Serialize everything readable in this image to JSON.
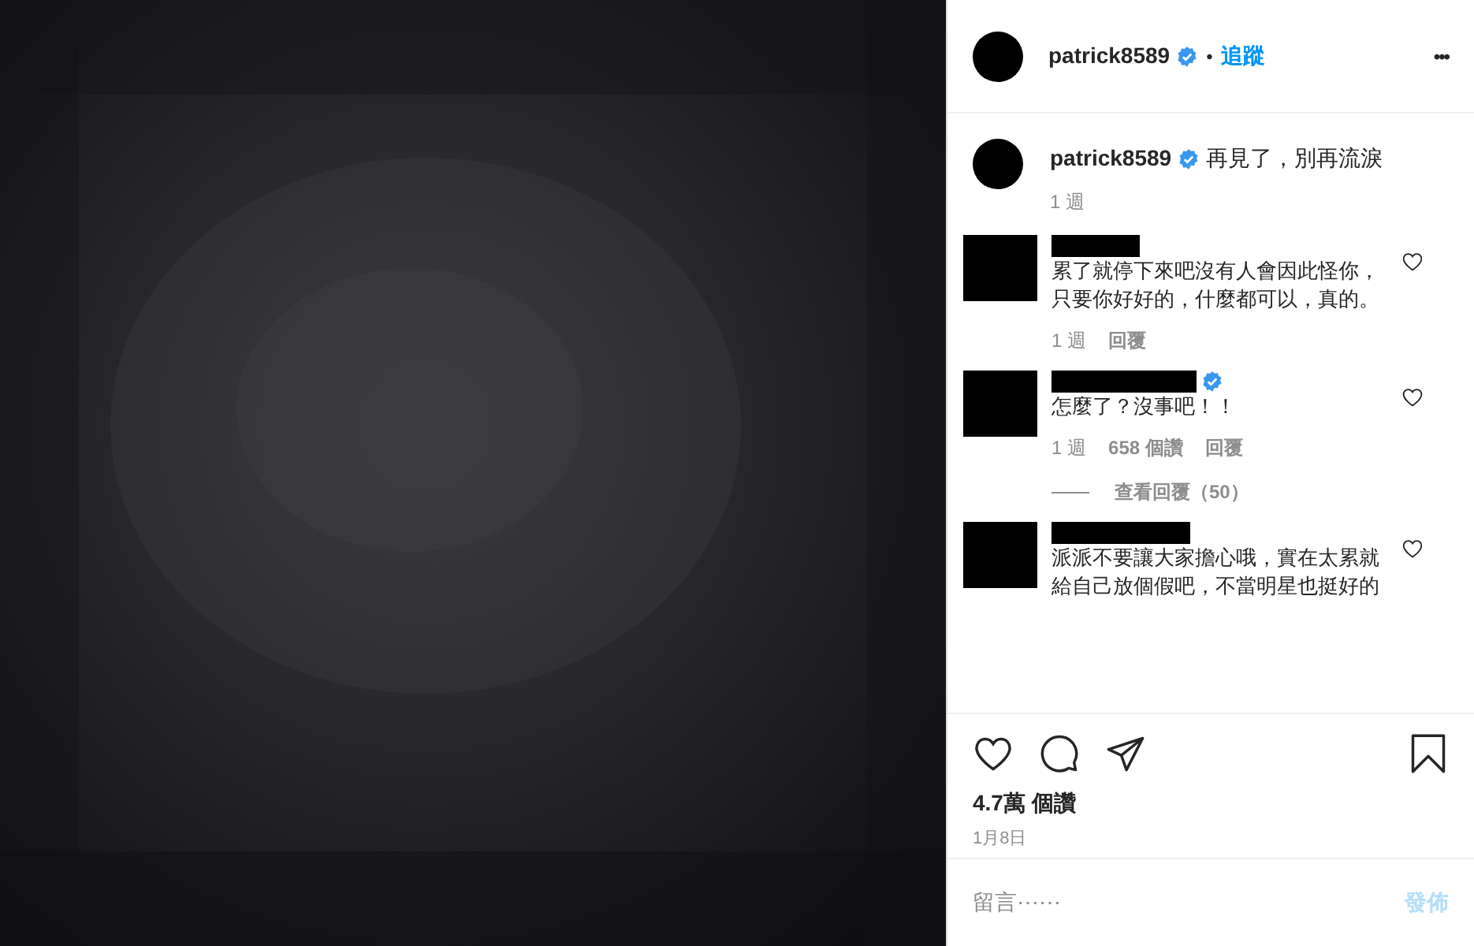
{
  "header": {
    "username": "patrick8589",
    "verified": true,
    "separator": "•",
    "follow": "追蹤",
    "more": "•••"
  },
  "caption": {
    "username": "patrick8589",
    "verified": true,
    "text": "再見了，別再流淚",
    "time": "1 週"
  },
  "comments": [
    {
      "verified": false,
      "text": "累了就停下來吧沒有人會因此怪你，只要你好好的，什麼都可以，真的。",
      "time": "1 週",
      "reply": "回覆"
    },
    {
      "verified": true,
      "text": "怎麼了？沒事吧！！",
      "time": "1 週",
      "likes": "658 個讚",
      "reply": "回覆",
      "view_replies": "查看回覆（50）"
    },
    {
      "verified": false,
      "text": "派派不要讓大家擔心哦，實在太累就給自己放個假吧，不當明星也挺好的"
    }
  ],
  "likes": "4.7萬 個讚",
  "date": "1月8日",
  "comment_box": {
    "placeholder": "留言⋯⋯",
    "post": "發佈",
    "disabled": true
  }
}
